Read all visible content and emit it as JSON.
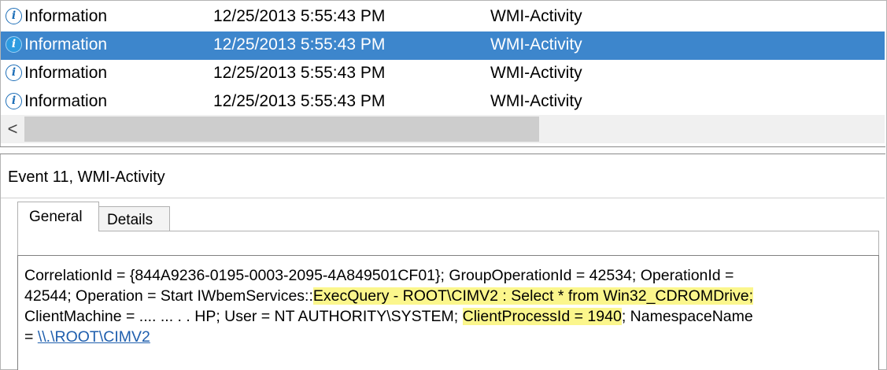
{
  "events": [
    {
      "level": "Information",
      "date": "12/25/2013 5:55:43 PM",
      "source": "WMI-Activity",
      "selected": false
    },
    {
      "level": "Information",
      "date": "12/25/2013 5:55:43 PM",
      "source": "WMI-Activity",
      "selected": true
    },
    {
      "level": "Information",
      "date": "12/25/2013 5:55:43 PM",
      "source": "WMI-Activity",
      "selected": false
    },
    {
      "level": "Information",
      "date": "12/25/2013 5:55:43 PM",
      "source": "WMI-Activity",
      "selected": false
    }
  ],
  "info_icon_glyph": "i",
  "scroll_left_glyph": "<",
  "detail": {
    "title": "Event 11, WMI-Activity",
    "tabs": {
      "general": "General",
      "details": "Details"
    },
    "message": {
      "line1": "CorrelationId = {844A9236-0195-0003-2095-4A849501CF01}; GroupOperationId = 42534; OperationId =",
      "line2_pre": "42544; Operation = Start IWbemServices::",
      "line2_highlight": "ExecQuery - ROOT\\CIMV2 : Select * from Win32_CDROMDrive;",
      "line3_pre": "ClientMachine = ",
      "line3_redacted": ".... ... . .",
      "line3_mid": "HP; User = NT AUTHORITY\\SYSTEM; ",
      "line3_highlight": "ClientProcessId = 1940",
      "line3_post": "; NamespaceName",
      "line4_pre": "= ",
      "line4_link": "\\\\.\\ROOT\\CIMV2"
    }
  },
  "colors": {
    "selection": "#3d86cc",
    "highlight": "#fbf68c",
    "link": "#1f5fae"
  }
}
